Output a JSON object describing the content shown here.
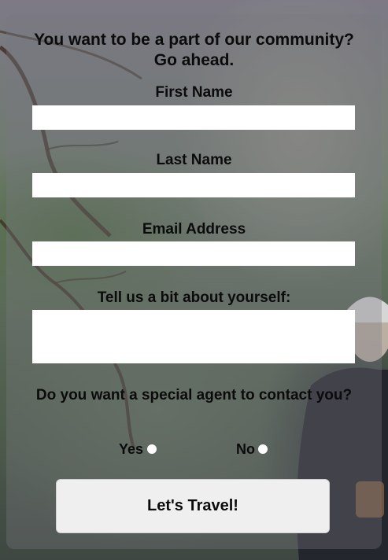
{
  "form": {
    "heading_line1": "You want to be a part of our community?",
    "heading_line2": "Go ahead.",
    "fields": {
      "first_name_label": "First Name",
      "last_name_label": "Last Name",
      "email_label": "Email Address",
      "about_label": "Tell us a bit about yourself:",
      "first_name_value": "",
      "last_name_value": "",
      "email_value": "",
      "about_value": ""
    },
    "agent_question": "Do you want a special agent to contact you?",
    "options": {
      "yes": "Yes",
      "no": "No"
    },
    "submit_label": "Let's Travel!"
  },
  "colors": {
    "panel_overlay": "rgba(120,120,130,0.35)",
    "input_bg": "#ffffff",
    "button_bg": "#efefef",
    "text": "#0b0b0b"
  }
}
